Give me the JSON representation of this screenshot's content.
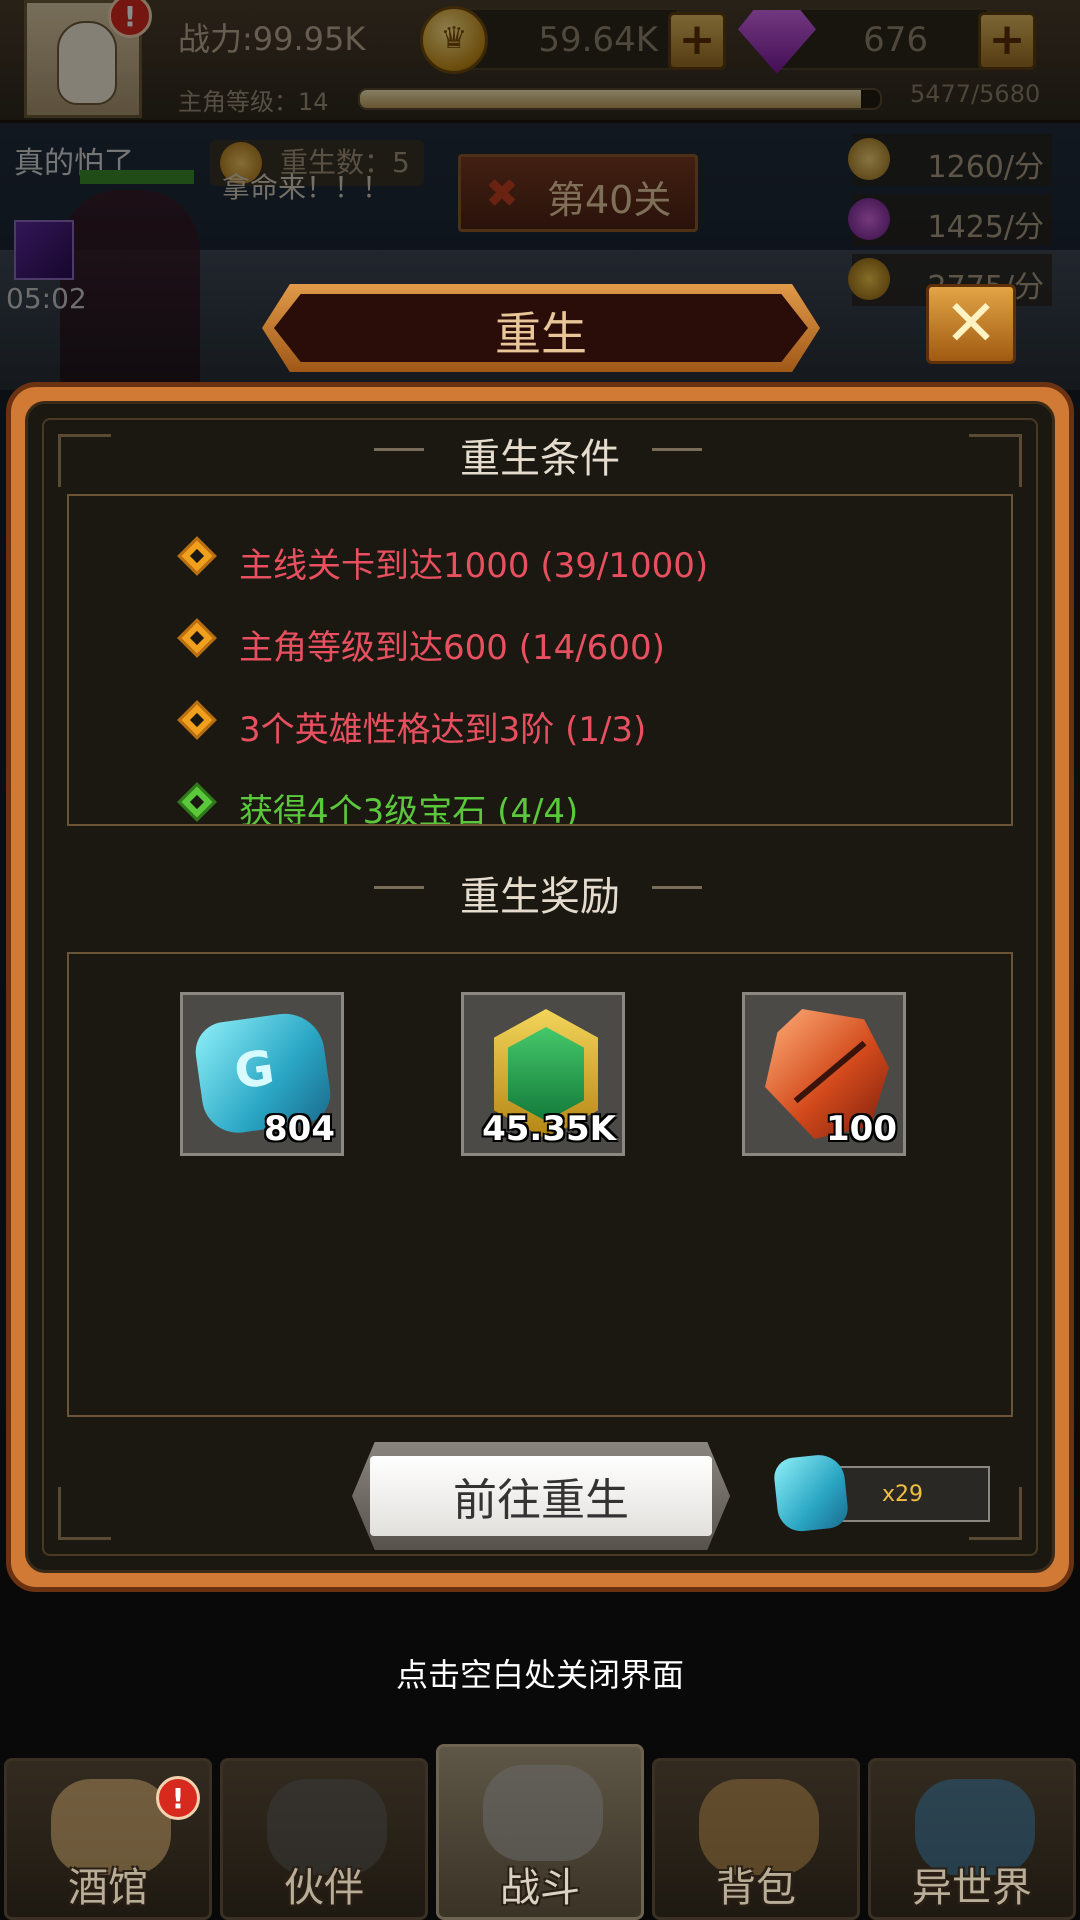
{
  "hud": {
    "power": "战力:99.95K",
    "level_label": "主角等级：14",
    "xp_text": "5477/5680",
    "xp_fraction": 0.964,
    "coins": "59.64K",
    "gems": "676",
    "alert": "!"
  },
  "battle": {
    "taunt": "真的怕了",
    "rebirth_count": "重生数：5",
    "speech": "拿命来！！！",
    "stage": "第40关",
    "timer": "05:02",
    "rates": [
      "1260/分",
      "1425/分",
      "2775/分"
    ]
  },
  "dialog": {
    "title": "重生",
    "close_icon": "close-x-icon",
    "conditions_title": "重生条件",
    "conditions": [
      {
        "text": "主线关卡到达1000 (39/1000)",
        "met": false
      },
      {
        "text": "主角等级到达600 (14/600)",
        "met": false
      },
      {
        "text": "3个英雄性格达到3阶 (1/3)",
        "met": false
      },
      {
        "text": "获得4个3级宝石 (4/4)",
        "met": true
      }
    ],
    "rewards_title": "重生奖励",
    "rewards": [
      {
        "icon": "rebirth-stone-icon",
        "count": "804"
      },
      {
        "icon": "green-badge-icon",
        "count": "45.35K"
      },
      {
        "icon": "red-crystal-icon",
        "count": "100"
      }
    ],
    "go_button": "前往重生",
    "cost": "x29"
  },
  "close_hint": "点击空白处关闭界面",
  "nav": [
    {
      "label": "酒馆",
      "icon": "tavern-mug-icon",
      "active": false
    },
    {
      "label": "伙伴",
      "icon": "partner-icon",
      "active": false
    },
    {
      "label": "战斗",
      "icon": "battle-swords-icon",
      "active": true
    },
    {
      "label": "背包",
      "icon": "backpack-chest-icon",
      "active": false
    },
    {
      "label": "异世界",
      "icon": "portal-icon",
      "active": false
    }
  ],
  "colors": {
    "condition_unmet": "#e8505f",
    "condition_met": "#5bc83c",
    "panel_border": "#d07a36"
  }
}
